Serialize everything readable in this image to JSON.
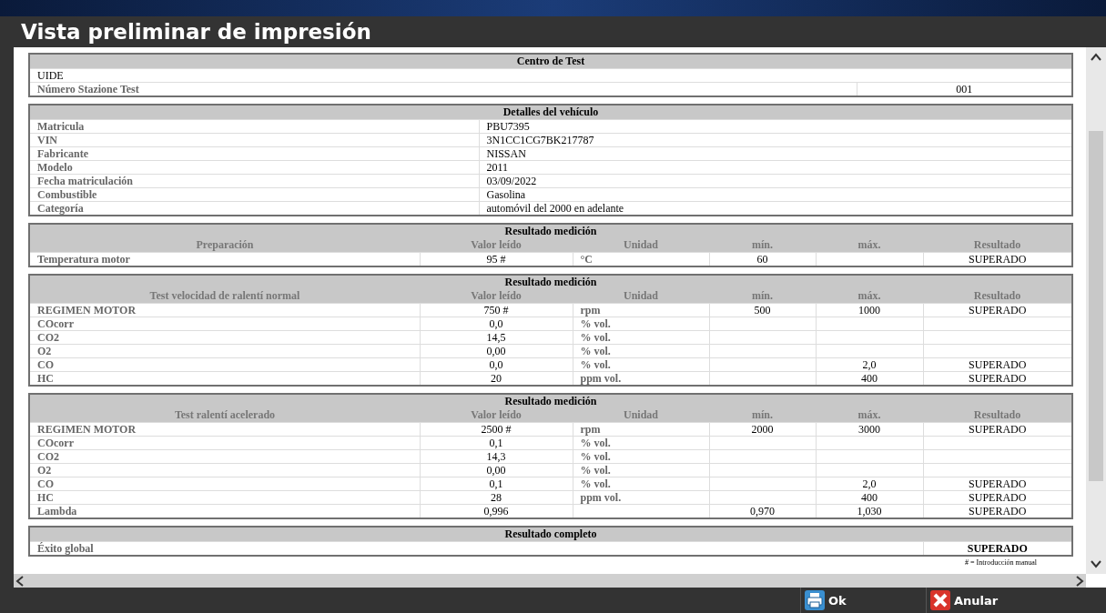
{
  "window": {
    "title": "Vista preliminar de impresión"
  },
  "centro": {
    "title": "Centro de Test",
    "rows": [
      {
        "kind": "plain",
        "label": "UIDE"
      },
      {
        "kind": "pair",
        "label": "Número Stazione Test",
        "value": "001"
      }
    ]
  },
  "vehiculo": {
    "title": "Detalles del vehículo",
    "rows": [
      {
        "label": "Matricula",
        "value": "PBU7395"
      },
      {
        "label": "VIN",
        "value": "3N1CC1CG7BK217787"
      },
      {
        "label": "Fabricante",
        "value": "NISSAN"
      },
      {
        "label": "Modelo",
        "value": "2011"
      },
      {
        "label": "Fecha matriculación",
        "value": "03/09/2022"
      },
      {
        "label": "Combustible",
        "value": "Gasolina"
      },
      {
        "label": "Categoría",
        "value": "automóvil del 2000 en adelante"
      }
    ]
  },
  "mediciones": [
    {
      "title": "Resultado medición",
      "columns": [
        "Preparación",
        "Valor leído",
        "Unidad",
        "mín.",
        "máx.",
        "Resultado"
      ],
      "rows": [
        [
          "Temperatura motor",
          "95 #",
          "°C",
          "60",
          "",
          "SUPERADO"
        ]
      ]
    },
    {
      "title": "Resultado medición",
      "columns": [
        "Test velocidad de ralentí normal",
        "Valor leído",
        "Unidad",
        "mín.",
        "máx.",
        "Resultado"
      ],
      "rows": [
        [
          "REGIMEN MOTOR",
          "750 #",
          "rpm",
          "500",
          "1000",
          "SUPERADO"
        ],
        [
          "COcorr",
          "0,0",
          "% vol.",
          "",
          "",
          ""
        ],
        [
          "CO2",
          "14,5",
          "% vol.",
          "",
          "",
          ""
        ],
        [
          "O2",
          "0,00",
          "% vol.",
          "",
          "",
          ""
        ],
        [
          "CO",
          "0,0",
          "% vol.",
          "",
          "2,0",
          "SUPERADO"
        ],
        [
          "HC",
          "20",
          "ppm vol.",
          "",
          "400",
          "SUPERADO"
        ]
      ]
    },
    {
      "title": "Resultado medición",
      "columns": [
        "Test ralentí acelerado",
        "Valor leído",
        "Unidad",
        "mín.",
        "máx.",
        "Resultado"
      ],
      "rows": [
        [
          "REGIMEN MOTOR",
          "2500 #",
          "rpm",
          "2000",
          "3000",
          "SUPERADO"
        ],
        [
          "COcorr",
          "0,1",
          "% vol.",
          "",
          "",
          ""
        ],
        [
          "CO2",
          "14,3",
          "% vol.",
          "",
          "",
          ""
        ],
        [
          "O2",
          "0,00",
          "% vol.",
          "",
          "",
          ""
        ],
        [
          "CO",
          "0,1",
          "% vol.",
          "",
          "2,0",
          "SUPERADO"
        ],
        [
          "HC",
          "28",
          "ppm vol.",
          "",
          "400",
          "SUPERADO"
        ],
        [
          "Lambda",
          "0,996",
          "",
          "0,970",
          "1,030",
          "SUPERADO"
        ]
      ]
    }
  ],
  "completo": {
    "title": "Resultado completo",
    "label": "Éxito global",
    "value": "SUPERADO"
  },
  "footnote": "# = Introducción manual",
  "buttons": [
    {
      "kind": "print",
      "label": "Ok"
    },
    {
      "kind": "cancel",
      "label": "Anular"
    }
  ]
}
